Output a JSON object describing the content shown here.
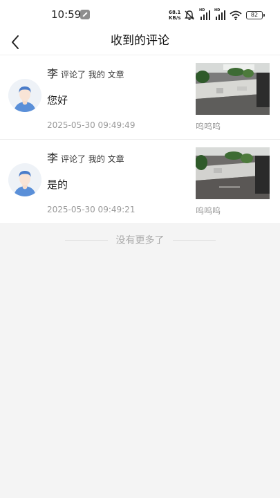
{
  "status_bar": {
    "time": "10:59",
    "net_speed_value": "68.1",
    "net_speed_unit": "KB/s",
    "battery": "82",
    "icons": [
      "wrench-icon",
      "mute-icon",
      "signal-hd-icon",
      "signal-hd-icon",
      "wifi-icon",
      "battery-icon"
    ]
  },
  "nav": {
    "back_icon": "chevron-left-icon",
    "title": "收到的评论"
  },
  "comments": [
    {
      "user": "李",
      "action": "评论了 我的 文章",
      "text": "您好",
      "time": "2025-05-30 09:49:49",
      "article_caption": "呜呜呜"
    },
    {
      "user": "李",
      "action": "评论了 我的 文章",
      "text": "是的",
      "time": "2025-05-30 09:49:21",
      "article_caption": "呜呜呜"
    }
  ],
  "footer": {
    "text": "没有更多了"
  },
  "colors": {
    "page_background": "#f4f4f4",
    "card_background": "#ffffff",
    "secondary_text": "#999999",
    "avatar_accent": "#5a8fd8"
  }
}
